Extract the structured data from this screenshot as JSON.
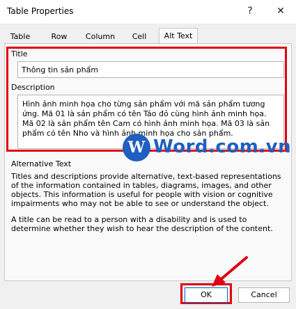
{
  "window": {
    "title": "Table Properties",
    "help": "?",
    "close": "✕"
  },
  "tabs": [
    {
      "label": "Table"
    },
    {
      "label": "Row"
    },
    {
      "label": "Column"
    },
    {
      "label": "Cell"
    },
    {
      "label": "Alt Text",
      "active": true
    }
  ],
  "alt_text": {
    "title_label": "Title",
    "title_value": "Thông tin sản phẩm",
    "description_label": "Description",
    "description_value": "Hình ảnh minh họa cho từng sản phẩm với mã sản phẩm tương ứng. Mã 01 là sản phẩm có tên Táo đỏ cùng hình ảnh minh họa. Mã 02 là sản phẩm tên Cam có hình ảnh minh họa. Mã 03 là sản phẩm có tên Nho và hình ảnh minh họa cho sản phẩm."
  },
  "info": {
    "heading": "Alternative Text",
    "para1": "Titles and descriptions provide alternative, text-based representations of the information contained in tables, diagrams, images, and other objects. This information is useful for people with vision or cognitive impairments who may not be able to see or understand the object.",
    "para2": "A title can be read to a person with a disability and is used to determine whether they wish to hear the description of the content."
  },
  "watermark": {
    "logo": "W",
    "text": "Word.com.vn"
  },
  "buttons": {
    "ok": "OK",
    "cancel": "Cancel"
  },
  "colors": {
    "highlight": "#e00010",
    "accent": "#0067c0",
    "watermark": "#1f5fbf"
  }
}
